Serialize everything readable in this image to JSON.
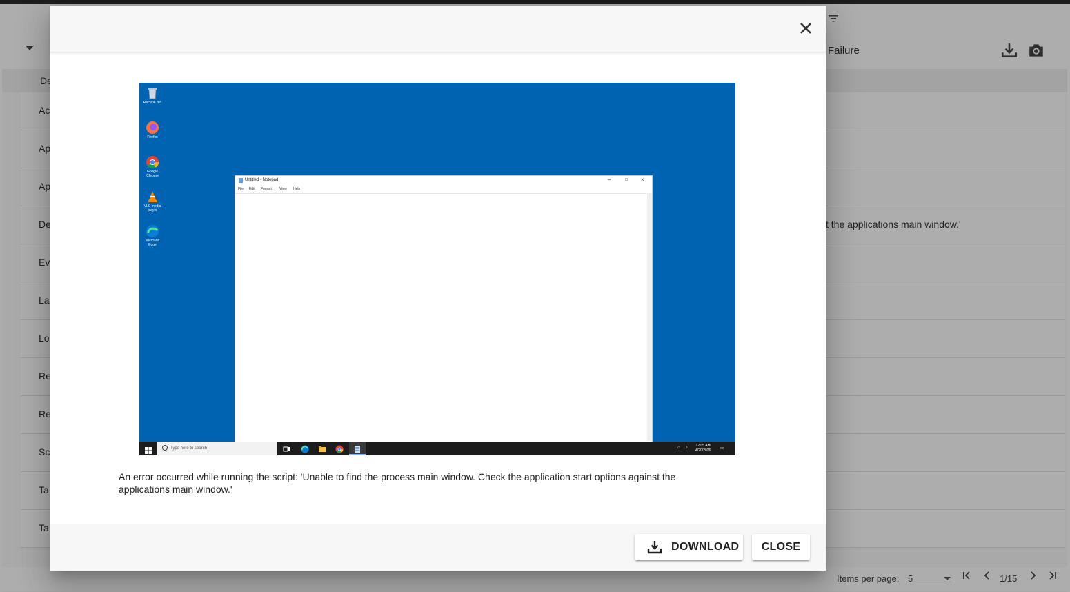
{
  "background": {
    "summary_status": "Failure",
    "details_label_partial": "De",
    "rows": [
      {
        "label": "Ac",
        "value": ""
      },
      {
        "label": "Ap",
        "value": ""
      },
      {
        "label": "Ap",
        "value": ""
      },
      {
        "label": "De",
        "value": "t the applications main window.'"
      },
      {
        "label": "Ev",
        "value": ""
      },
      {
        "label": "La",
        "value": ""
      },
      {
        "label": "Lo",
        "value": ""
      },
      {
        "label": "Re",
        "value": ""
      },
      {
        "label": "Re",
        "value": ""
      },
      {
        "label": "Sc",
        "value": ""
      },
      {
        "label": "Ta",
        "value": ""
      },
      {
        "label": "Ta",
        "value": ""
      }
    ],
    "pagination": {
      "items_per_page_label": "Items per page:",
      "items_per_page_value": "5",
      "page_indicator": "1/15"
    }
  },
  "dialog": {
    "message": "An error occurred while running the script: 'Unable to find the process main window. Check the application start options against the applications main window.'",
    "download_label": "DOWNLOAD",
    "close_label": "CLOSE"
  },
  "screenshot": {
    "desktop_icons": [
      {
        "label": "Recycle Bin",
        "icon": "recycle-bin-icon"
      },
      {
        "label": "Firefox",
        "icon": "firefox-icon"
      },
      {
        "label": "Google Chrome",
        "icon": "chrome-icon"
      },
      {
        "label": "VLC media player",
        "icon": "vlc-icon"
      },
      {
        "label": "Microsoft Edge",
        "icon": "edge-icon"
      }
    ],
    "notepad_title": "Untitled - Notepad",
    "notepad_menu": [
      "File",
      "Edit",
      "Format",
      "View",
      "Help"
    ],
    "taskbar_search_placeholder": "Type here to search",
    "clock_time": "12:05 AM",
    "clock_date": "4/20/2026"
  }
}
